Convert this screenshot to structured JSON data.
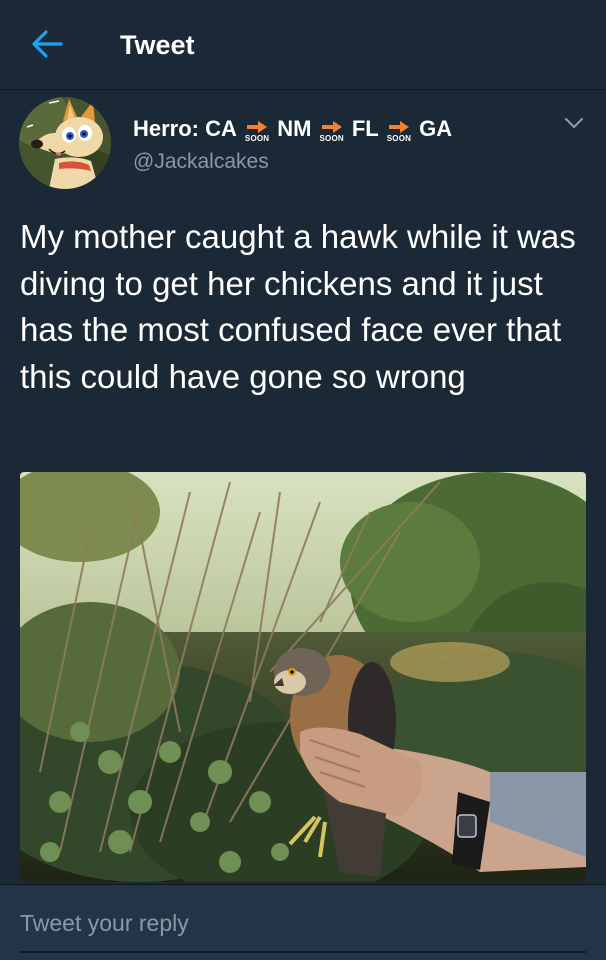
{
  "header": {
    "title": "Tweet",
    "back_icon": "arrow-left-icon"
  },
  "author": {
    "name_stops": [
      "Herro: CA",
      "NM",
      "FL",
      "GA"
    ],
    "arrow_label": "SOON",
    "handle": "@Jackalcakes",
    "avatar_icon": "jackal-avatar"
  },
  "tweet": {
    "text": "My mother caught a hawk while it was diving to get her chickens and it just has the most confused face ever that this could have gone so wrong"
  },
  "reply": {
    "placeholder": "Tweet your reply"
  },
  "colors": {
    "accent": "#1da1f2",
    "background": "#1b2836",
    "secondary_text": "#8899a6",
    "soon_arrow": "#f4812f"
  }
}
